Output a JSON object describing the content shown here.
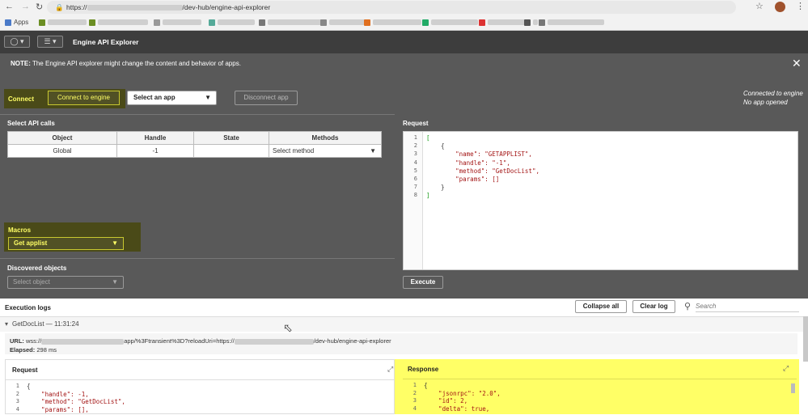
{
  "browser": {
    "url_prefix": "https://",
    "url_suffix": "/dev-hub/engine-api-explorer",
    "bookmarks": {
      "apps_label": "Apps"
    }
  },
  "toolbar": {
    "title": "Engine API Explorer"
  },
  "note": {
    "label": "NOTE:",
    "text": "The Engine API explorer might change the content and behavior of apps."
  },
  "connect": {
    "label": "Connect",
    "connect_button": "Connect to engine",
    "select_app": "Select an app",
    "disconnect_button": "Disconnect app",
    "status_line1": "Connected to engine",
    "status_line2": "No app opened"
  },
  "api_calls": {
    "label": "Select API calls",
    "columns": [
      "Object",
      "Handle",
      "State",
      "Methods"
    ],
    "row": {
      "object": "Global",
      "handle": "-1",
      "state": "",
      "method": "Select method"
    }
  },
  "macros": {
    "label": "Macros",
    "selected": "Get applist"
  },
  "discovered": {
    "label": "Discovered objects",
    "placeholder": "Select object"
  },
  "request": {
    "label": "Request",
    "execute_button": "Execute",
    "lines": [
      "[",
      "    {",
      "        \"name\": \"GETAPPLIST\",",
      "        \"handle\": \"-1\",",
      "        \"method\": \"GetDocList\",",
      "        \"params\": []",
      "    }",
      "]"
    ]
  },
  "logs": {
    "label": "Execution logs",
    "collapse_all": "Collapse all",
    "clear_log": "Clear log",
    "search_placeholder": "Search",
    "entry_title": "GetDocList — 11:31:24",
    "url_label": "URL:",
    "url_prefix": "wss://",
    "url_mid": "app/%3Ftransient%3D?reloadUri=https://",
    "url_suffix": "/dev-hub/engine-api-explorer",
    "elapsed_label": "Elapsed:",
    "elapsed_value": "298 ms",
    "request_title": "Request",
    "response_title": "Response",
    "request_lines": [
      "{",
      "    \"handle\": -1,",
      "    \"method\": \"GetDocList\",",
      "    \"params\": [],"
    ],
    "response_lines": [
      "{",
      "    \"jsonrpc\": \"2.0\",",
      "    \"id\": 2,",
      "    \"delta\": true,"
    ]
  },
  "colors": {
    "highlight": "#ffff66",
    "toolbar": "#3d3d3d",
    "panel": "#595959"
  }
}
